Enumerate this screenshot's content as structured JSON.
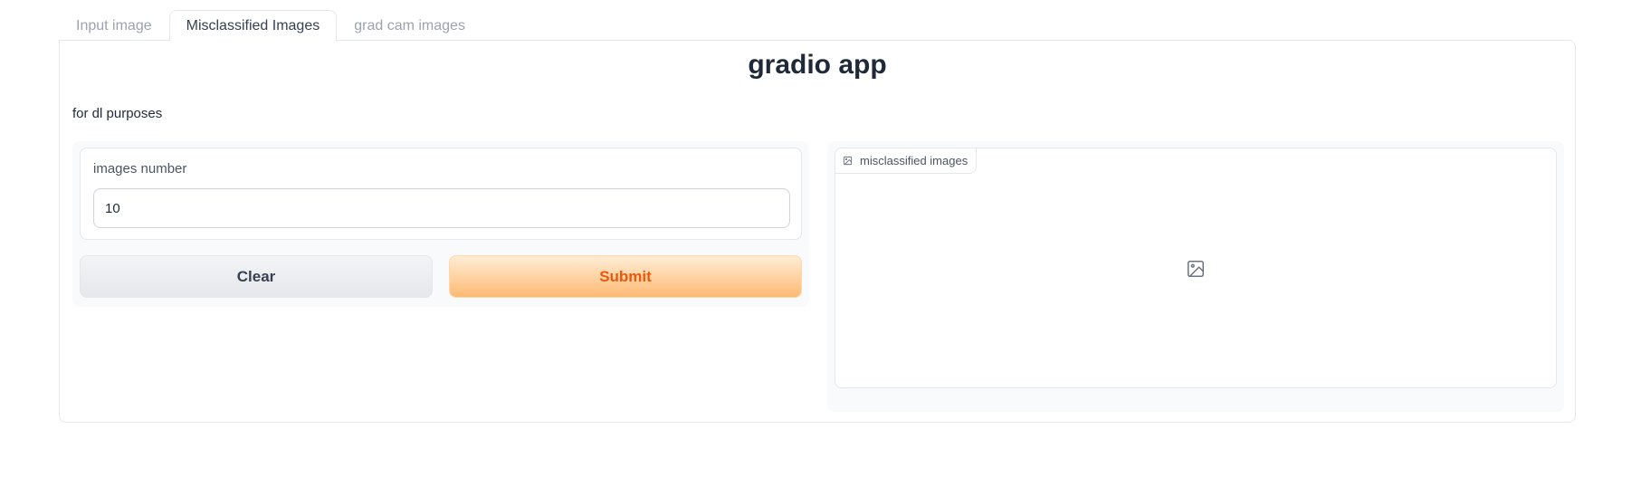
{
  "tabs": [
    {
      "label": "Input image"
    },
    {
      "label": "Misclassified Images",
      "active": true
    },
    {
      "label": "grad cam images"
    }
  ],
  "app": {
    "title": "gradio app",
    "description": "for dl purposes"
  },
  "inputs": {
    "images_number": {
      "label": "images number",
      "value": "10"
    }
  },
  "buttons": {
    "clear_label": "Clear",
    "submit_label": "Submit"
  },
  "output": {
    "label": "misclassified images",
    "label_icon": "image-icon",
    "placeholder_icon": "image-icon"
  },
  "colors": {
    "accent": "#ea580c",
    "submit_bg": "#fdba74",
    "border": "#e5e7eb"
  }
}
